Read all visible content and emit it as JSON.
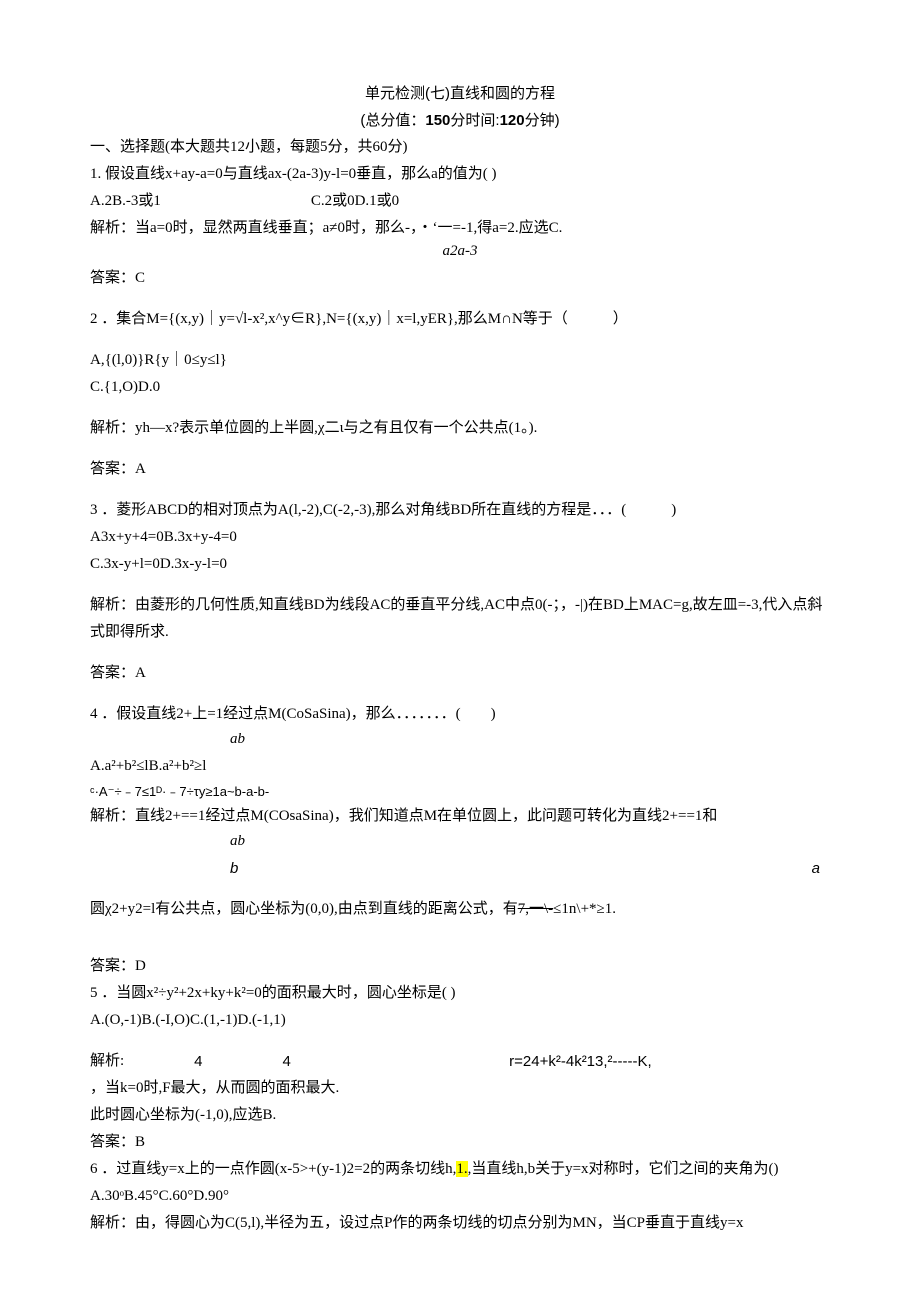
{
  "title": "单元检测(七)直线和圆的方程",
  "subtitle_prefix": "(总分值：",
  "subtitle_bold1": "150",
  "subtitle_mid": "分时间:",
  "subtitle_bold2": "120",
  "subtitle_suffix": "分钟)",
  "sec1_heading": "一、选择题(本大题共12小题，每题5分，共60分)",
  "q1_text": "1. 假设直线x+ay-a=0与直线ax-(2a-3)y-l=0垂直，那么a的值为( )",
  "q1_opts_left": "A.2B.-3或1",
  "q1_opts_right": "C.2或0D.1或0",
  "q1_analysis": "解析：当a=0时，显然两直线垂直；a≠0时，那么-，・‘一=-1,得a=2.应选C.",
  "q1_below": "a2a-3",
  "q1_answer": "答案：C",
  "q2_text": "2 ．集合M={(x,y)｜y=√l-x²,x^y∈R},N={(x,y)｜x=l,yER},那么M∩N等于（　　　）",
  "q2_optA": "A,{(l,0)}R{y｜0≤y≤l}",
  "q2_optC": "C.{1,O)D.0",
  "q2_analysis": "解析：yh—x?表示单位圆的上半圆,χ二ι与之有且仅有一个公共点(1。).",
  "q2_answer": "答案：A",
  "q3_text": "3 ．菱形ABCD的相对顶点为A(l,-2),C(-2,-3),那么对角线BD所在直线的方程是．．．(　　　)",
  "q3_optsAB": "A3x+y+4=0B.3x+y-4=0",
  "q3_optsCD": "C.3x-y+l=0D.3x-y-l=0",
  "q3_analysis": "解析：由菱形的几何性质,知直线BD为线段AC的垂直平分线,AC中点0(-；，-|)在BD上MAC=g,故左皿=-3,代入点斜式即得所求.",
  "q3_answer": "答案：A",
  "q4_text": "4 ．假设直线2+上=1经过点M(CoSaSina)，那么．．．．．．．(　　)",
  "q4_below": "ab",
  "q4_optsAB": "A.a²+b²≤lB.a²+b²≥l",
  "q4_optsCD": "ᶜ·A⁻÷﹣7≤1ᴰ·﹣7÷τy≥1a~b-a-b-",
  "q4_analysis1": "解析：直线2+==1经过点M(COsaSina)，我们知道点M在单位圆上，此问题可转化为直线2+==1和",
  "q4_below2": "ab",
  "q4_b": "b",
  "q4_a": "a",
  "q4_analysis2_pre": "圆χ2+y2=l有公共点，圆心坐标为(0,0),由点到直线的距离公式，有",
  "q4_strike": "7,一\\-",
  "q4_analysis2_post": "≤1n\\+*≥1.",
  "q4_answer": "答案：D",
  "q5_text": "5 ．当圆x²÷y²+2x+ky+k²=0的面积最大时，圆心坐标是( )",
  "q5_opts": "A.(O,-1)B.(-I,O)C.(1,-1)D.(-1,1)",
  "q5_analysis_label": "解析:",
  "q5_n1": "4",
  "q5_n2": "4",
  "q5_rest": "r=24+k²-4k²13,²-----K,",
  "q5_rest_below": "----------",
  "q5_line2": "，当k=0时,F最大，从而圆的面积最大.",
  "q5_line3": "此时圆心坐标为(-1,0),应选B.",
  "q5_answer": "答案：B",
  "q6_text_pre": "6 ．过直线y=x上的一点作圆(x-5>+(y-1)2=2的两条切线h,",
  "q6_hl": "1.",
  "q6_text_post": ",当直线h,b关于y=x对称时，它们之间的夹角为()",
  "q6_opts": "A.30ᵒB.45°C.60°D.90°",
  "q6_analysis": "解析：由，得圆心为C(5,l),半径为五，设过点P作的两条切线的切点分别为MN，当CP垂直于直线y=x"
}
